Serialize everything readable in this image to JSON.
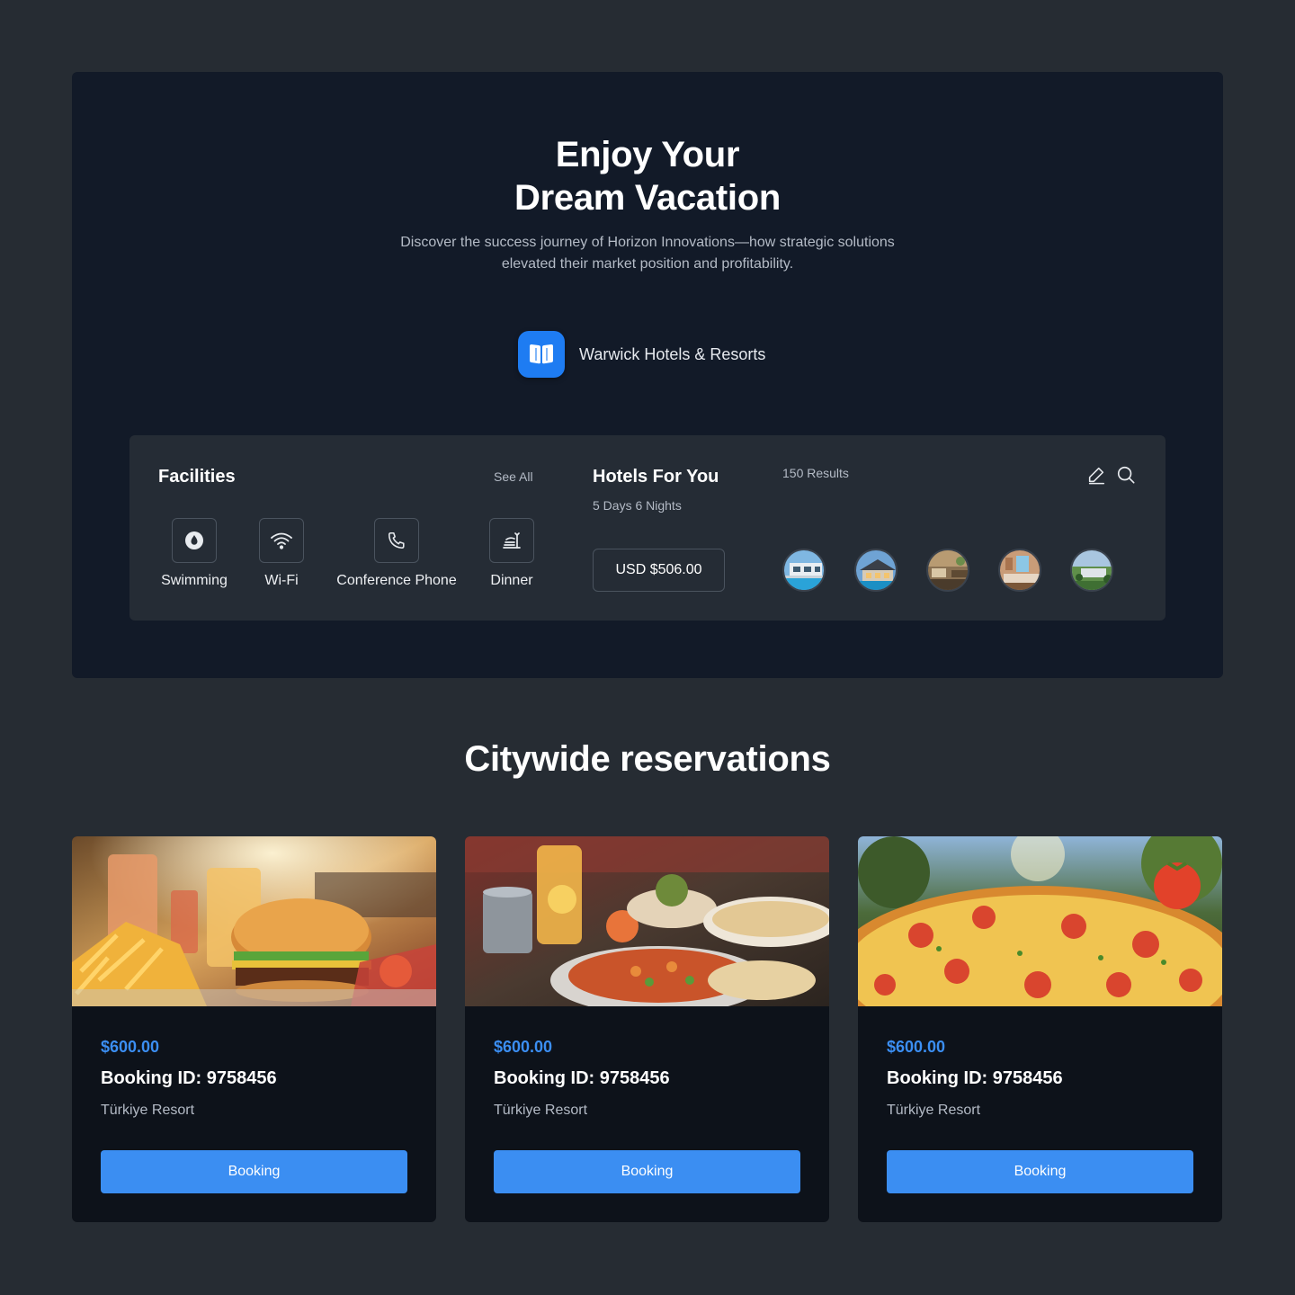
{
  "hero": {
    "title_line1": "Enjoy Your",
    "title_line2": "Dream Vacation",
    "subtitle": "Discover the success journey of Horizon Innovations—how strategic solutions elevated their market position and profitability.",
    "brand": {
      "name": "Warwick Hotels & Resorts",
      "logo_icon": "book-open-icon",
      "color": "#1e7cf2"
    }
  },
  "facilities": {
    "title": "Facilities",
    "see_all": "See All",
    "items": [
      {
        "label": "Swimming",
        "icon": "drop-icon"
      },
      {
        "label": "Wi-Fi",
        "icon": "wifi-icon"
      },
      {
        "label": "Conference Phone",
        "icon": "phone-icon"
      },
      {
        "label": "Dinner",
        "icon": "dinner-icon"
      }
    ]
  },
  "hotels": {
    "title": "Hotels For You",
    "duration": "5 Days 6 Nights",
    "results": "150 Results",
    "price": "USD $506.00",
    "tools": [
      "edit-icon",
      "search-icon"
    ],
    "thumbnails": [
      "hotel-pool",
      "hotel-villa",
      "hotel-lobby",
      "hotel-room",
      "hotel-aerial"
    ]
  },
  "reservations": {
    "title": "Citywide reservations",
    "cards": [
      {
        "image": "burger-fries-drinks",
        "price": "$600.00",
        "booking_id": "Booking ID: 9758456",
        "location": "Türkiye Resort",
        "button": "Booking"
      },
      {
        "image": "curry-flatbread-table",
        "price": "$600.00",
        "booking_id": "Booking ID: 9758456",
        "location": "Türkiye Resort",
        "button": "Booking"
      },
      {
        "image": "pizza-tomatoes",
        "price": "$600.00",
        "booking_id": "Booking ID: 9758456",
        "location": "Türkiye Resort",
        "button": "Booking"
      }
    ]
  },
  "colors": {
    "page_bg": "#262c33",
    "hero_bg": "#121a28",
    "panel_bg": "#252c35",
    "card_bg": "#0d121a",
    "accent": "#3b8ef2"
  }
}
